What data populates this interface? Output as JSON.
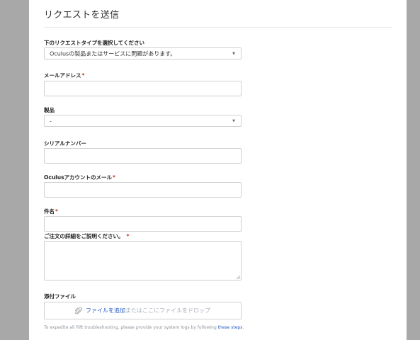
{
  "form": {
    "title": "リクエストを送信",
    "required_marker": "*",
    "request_type": {
      "label": "下のリクエストタイプを選択してください",
      "value": "Oculusの製品またはサービスに問題があります。"
    },
    "email": {
      "label": "メールアドレス",
      "value": ""
    },
    "product": {
      "label": "製品",
      "value": "-"
    },
    "serial": {
      "label": "シリアルナンバー",
      "value": ""
    },
    "oculus_email": {
      "label": "Oculusアカウントのメール",
      "value": ""
    },
    "subject": {
      "label": "件名",
      "value": ""
    },
    "details": {
      "label": "ご注文の詳細をご説明ください。",
      "value": ""
    },
    "attachments": {
      "label": "添付ファイル",
      "add_link": "ファイルを追加",
      "drop_text": "またはここにファイルをドロップ"
    },
    "footnote": {
      "text": "To expedite all Rift troubleshooting, please provide your system logs by following ",
      "link": "these steps",
      "end": "."
    }
  }
}
